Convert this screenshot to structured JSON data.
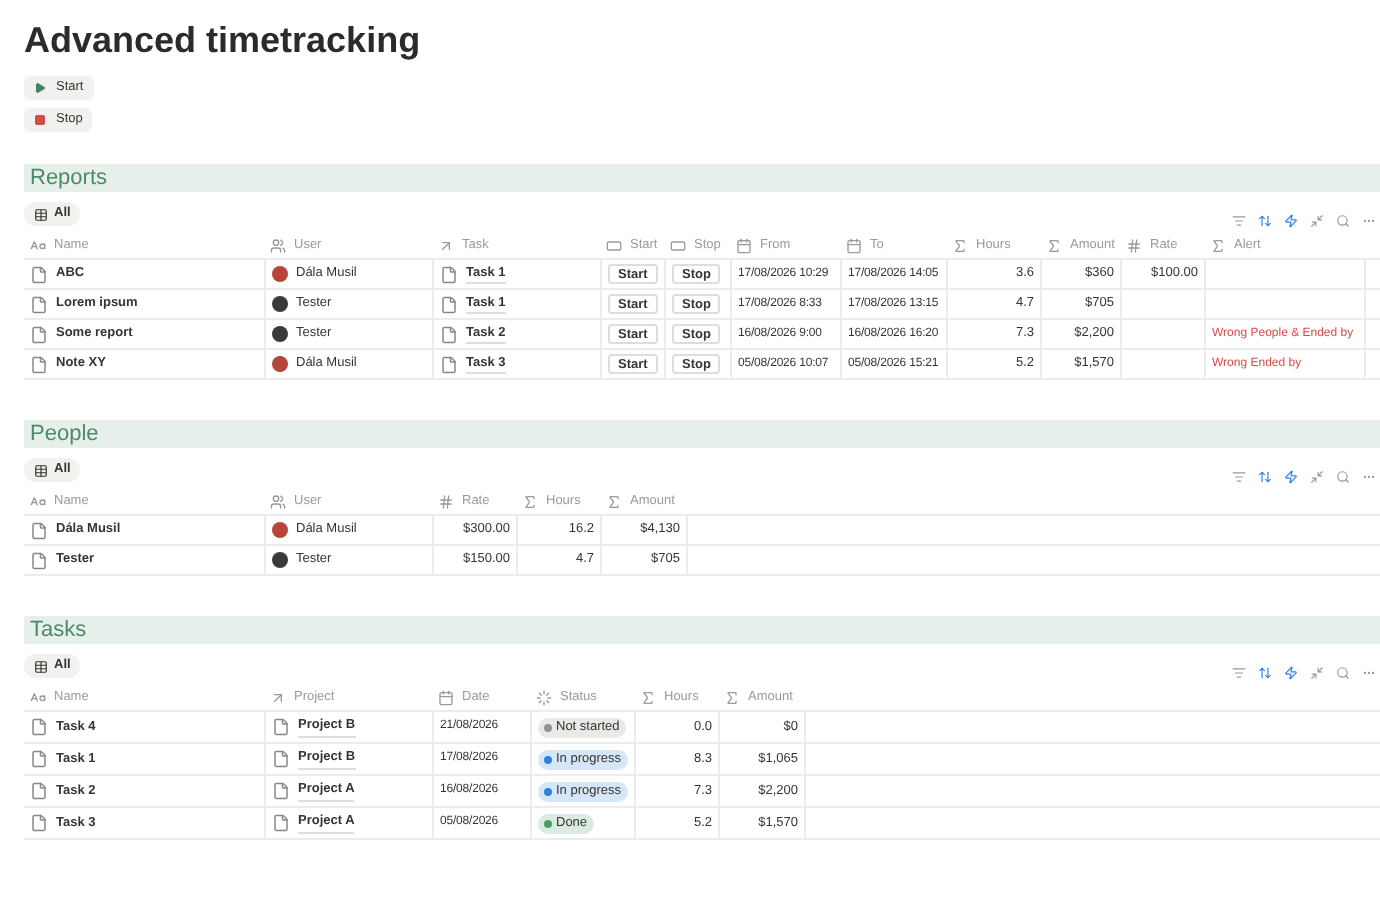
{
  "page": {
    "title": "Advanced timetracking",
    "buttons": [
      {
        "label": "Start",
        "kind": "play"
      },
      {
        "label": "Stop",
        "kind": "stop"
      }
    ]
  },
  "sections": [
    {
      "title": "Reports",
      "view": "All",
      "columns": [
        {
          "label": "Name",
          "kind": "title"
        },
        {
          "label": "User",
          "kind": "person"
        },
        {
          "label": "Task",
          "kind": "relation"
        },
        {
          "label": "Start",
          "kind": "button"
        },
        {
          "label": "Stop",
          "kind": "button"
        },
        {
          "label": "From",
          "kind": "date"
        },
        {
          "label": "To",
          "kind": "date"
        },
        {
          "label": "Hours",
          "kind": "formula"
        },
        {
          "label": "Amount",
          "kind": "formula"
        },
        {
          "label": "Rate",
          "kind": "number"
        },
        {
          "label": "Alert",
          "kind": "alert"
        }
      ],
      "rows": [
        {
          "cells": [
            "ABC",
            {
              "name": "Dála Musil",
              "color": "#b5473a"
            },
            "Task 1",
            "Start",
            "Stop",
            "17/08/2026 10:29",
            "17/08/2026 14:05",
            "3.6",
            "$360",
            "$100.00",
            null
          ]
        },
        {
          "cells": [
            "Lorem ipsum",
            {
              "name": "Tester",
              "color": "#3a3a3a"
            },
            "Task 1",
            "Start",
            "Stop",
            "17/08/2026 8:33",
            "17/08/2026 13:15",
            "4.7",
            "$705",
            null,
            null
          ]
        },
        {
          "cells": [
            "Some report",
            {
              "name": "Tester",
              "color": "#3a3a3a"
            },
            "Task 2",
            "Start",
            "Stop",
            "16/08/2026 9:00",
            "16/08/2026 16:20",
            "7.3",
            "$2,200",
            null,
            "Wrong People & Ended by"
          ]
        },
        {
          "cells": [
            "Note XY",
            {
              "name": "Dála Musil",
              "color": "#b5473a"
            },
            "Task 3",
            "Start",
            "Stop",
            "05/08/2026 10:07",
            "05/08/2026 15:21",
            "5.2",
            "$1,570",
            null,
            "Wrong Ended by"
          ]
        }
      ]
    },
    {
      "title": "People",
      "view": "All",
      "columns": [
        {
          "label": "Name",
          "kind": "title"
        },
        {
          "label": "User",
          "kind": "person"
        },
        {
          "label": "Rate",
          "kind": "number"
        },
        {
          "label": "Hours",
          "kind": "formula"
        },
        {
          "label": "Amount",
          "kind": "formula"
        }
      ],
      "rows": [
        {
          "cells": [
            "Dála Musil",
            {
              "name": "Dála Musil",
              "color": "#b5473a"
            },
            "$300.00",
            "16.2",
            "$4,130"
          ]
        },
        {
          "cells": [
            "Tester",
            {
              "name": "Tester",
              "color": "#3a3a3a"
            },
            "$150.00",
            "4.7",
            "$705"
          ]
        }
      ]
    },
    {
      "title": "Tasks",
      "view": "All",
      "columns": [
        {
          "label": "Name",
          "kind": "title"
        },
        {
          "label": "Project",
          "kind": "relation"
        },
        {
          "label": "Date",
          "kind": "date"
        },
        {
          "label": "Status",
          "kind": "status"
        },
        {
          "label": "Hours",
          "kind": "formula"
        },
        {
          "label": "Amount",
          "kind": "formula"
        }
      ],
      "rows": [
        {
          "cells": [
            "Task 4",
            "Project B",
            "21/08/2026",
            {
              "text": "Not started",
              "color": "#91918e"
            },
            "0.0",
            "$0"
          ]
        },
        {
          "cells": [
            "Task 1",
            "Project B",
            "17/08/2026",
            {
              "text": "In progress",
              "color": "#2f80e0"
            },
            "8.3",
            "$1,065"
          ]
        },
        {
          "cells": [
            "Task 2",
            "Project A",
            "16/08/2026",
            {
              "text": "In progress",
              "color": "#2f80e0"
            },
            "7.3",
            "$2,200"
          ]
        },
        {
          "cells": [
            "Task 3",
            "Project A",
            "05/08/2026",
            {
              "text": "Done",
              "color": "#4c9a6a"
            },
            "5.2",
            "$1,570"
          ]
        }
      ]
    }
  ]
}
